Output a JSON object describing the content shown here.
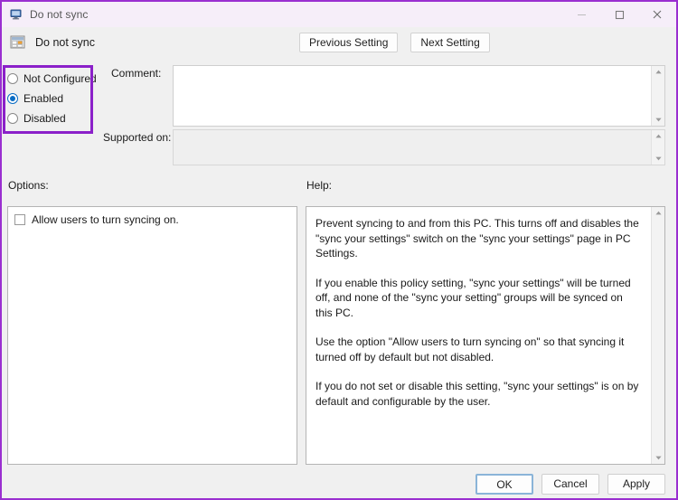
{
  "window": {
    "title": "Do not sync",
    "title_icon": "computer-monitor-icon",
    "controls": {
      "minimize": "minimize-icon",
      "maximize": "maximize-icon",
      "close": "close-icon"
    }
  },
  "header": {
    "policy_icon": "policy-setting-icon",
    "policy_name": "Do not sync",
    "previous_button": "Previous Setting",
    "next_button": "Next Setting"
  },
  "state": {
    "options": [
      {
        "label": "Not Configured",
        "selected": false
      },
      {
        "label": "Enabled",
        "selected": true
      },
      {
        "label": "Disabled",
        "selected": false
      }
    ],
    "highlight_color": "#8b20c9"
  },
  "fields": {
    "comment_label": "Comment:",
    "comment_value": "",
    "supported_label": "Supported on:",
    "supported_value": ""
  },
  "sections": {
    "options_label": "Options:",
    "help_label": "Help:"
  },
  "options_panel": {
    "checkbox_label": "Allow users to turn syncing on.",
    "checked": false
  },
  "help_panel": {
    "paragraphs": [
      "Prevent syncing to and from this PC.  This turns off and disables the \"sync your settings\" switch on the \"sync your settings\" page in PC Settings.",
      "If you enable this policy setting, \"sync your settings\" will be turned off, and none of the \"sync your setting\" groups will be synced on this PC.",
      "Use the option \"Allow users to turn syncing on\" so that syncing it turned off by default but not disabled.",
      "If you do not set or disable this setting, \"sync your settings\" is on by default and configurable by the user."
    ]
  },
  "footer": {
    "ok": "OK",
    "cancel": "Cancel",
    "apply": "Apply"
  }
}
